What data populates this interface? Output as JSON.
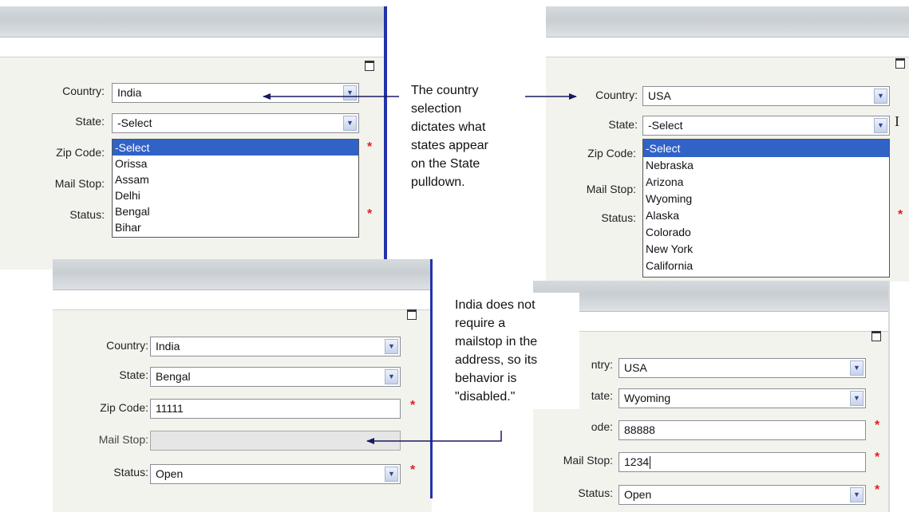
{
  "labels": {
    "country": "Country:",
    "state": "State:",
    "zip": "Zip Code:",
    "mailstop": "Mail Stop:",
    "status": "Status:"
  },
  "cropped_labels": {
    "country": "ntry:",
    "state": "tate:",
    "zip": "ode:"
  },
  "top_left": {
    "country_value": "India",
    "state_value": "-Select",
    "state_options": [
      "-Select",
      "Orissa",
      "Assam",
      "Delhi",
      "Bengal",
      "Bihar"
    ]
  },
  "top_right": {
    "country_value": "USA",
    "state_value": "-Select",
    "state_options": [
      "-Select",
      "Nebraska",
      "Arizona",
      "Wyoming",
      "Alaska",
      "Colorado",
      "New York",
      "California"
    ]
  },
  "bottom_left": {
    "country_value": "India",
    "state_value": "Bengal",
    "zip_value": "11111",
    "mailstop_value": "",
    "status_value": "Open"
  },
  "bottom_right": {
    "country_value": "USA",
    "state_value": "Wyoming",
    "zip_value": "88888",
    "mailstop_value": "1234",
    "status_value": "Open"
  },
  "annotations": {
    "country_note": [
      "The country",
      "selection",
      "dictates what",
      "states appear",
      "on the State",
      "pulldown."
    ],
    "mailstop_note": [
      "India does not",
      "require a",
      "mailstop in the",
      "address, so its",
      "behavior is",
      "\"disabled.\""
    ]
  },
  "icons": {
    "dropdown": "chevron-down-icon",
    "maximize": "maximize-icon",
    "required": "*",
    "text_cursor": "I"
  },
  "colors": {
    "highlight": "#3162c6",
    "required": "#e02020",
    "frame_line": "#2233a8"
  }
}
